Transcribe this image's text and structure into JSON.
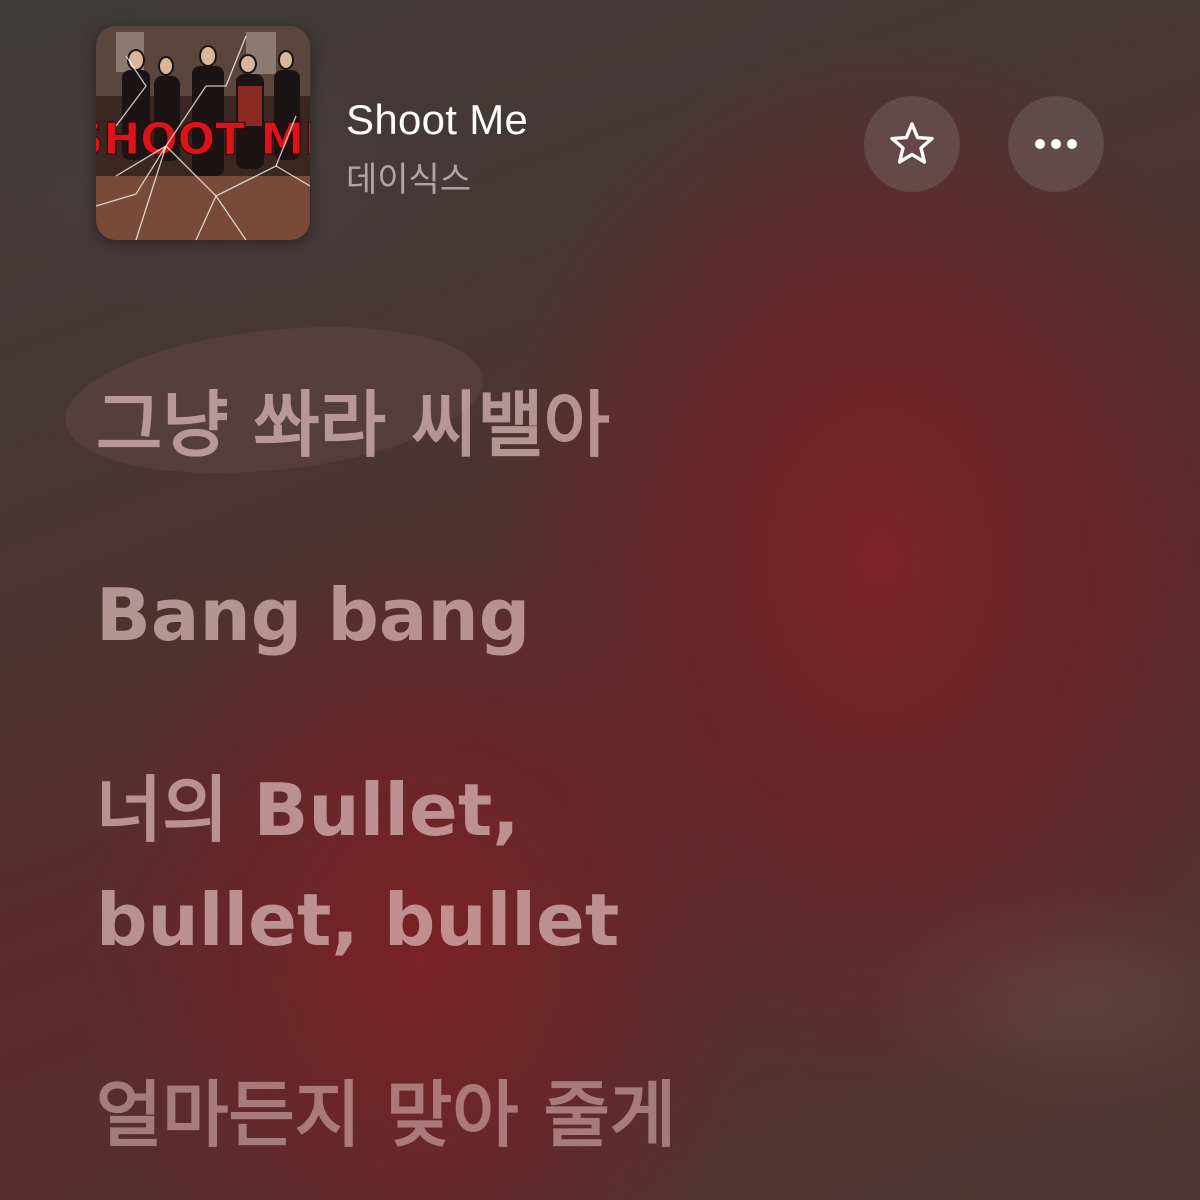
{
  "track": {
    "title": "Shoot Me",
    "artist": "데이식스"
  },
  "album_art": {
    "cover_text": "SHOOT ME",
    "accent_color": "#d8151b"
  },
  "actions": {
    "favorite_icon": "star-outline-icon",
    "more_icon": "ellipsis-icon"
  },
  "lyrics": {
    "lines": [
      "그냥 쏴라 씨밸아",
      "Bang bang",
      "너의 Bullet,\nbullet, bullet",
      "얼마든지 맞아 줄게"
    ]
  },
  "colors": {
    "background_top": "#3e3b3a",
    "background_accent": "#7c2224",
    "lyric_text": "#e1bebe",
    "title_text": "#ffffff"
  }
}
